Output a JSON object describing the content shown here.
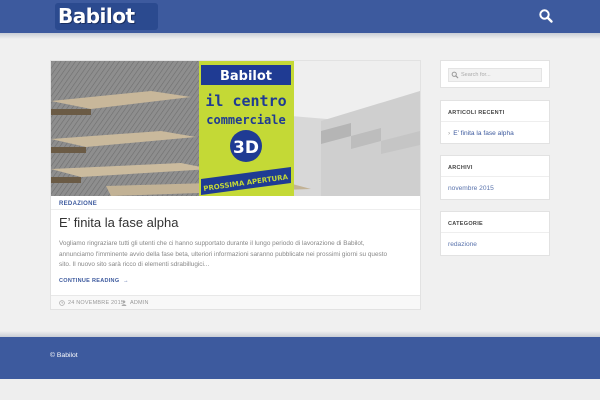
{
  "header": {
    "logo_text": "Babilot",
    "search_icon": "search-icon",
    "color": "#3d5a9e"
  },
  "post": {
    "hero_sign": {
      "brand": "Babilot",
      "line1": "il centro",
      "line2": "commerciale",
      "line3": "3D",
      "banner": "PROSSIMA APERTURA"
    },
    "category": "REDAZIONE",
    "title": "E’ finita la fase alpha",
    "excerpt": "Vogliamo ringraziare tutti gli utenti che ci hanno supportato durante il lungo periodo di lavorazione di Babilot, annunciamo l'imminente avvio della fase beta, ulteriori informazioni saranno pubblicate nei prossimi giorni su questo sito. Il nuovo sito sarà ricco di elementi sdrabillugici...",
    "read_more": "CONTINUE READING",
    "date": "24 NOVEMBRE 2015",
    "author": "ADMIN"
  },
  "sidebar": {
    "search_placeholder": "Search for...",
    "recent_title": "ARTICOLI RECENTI",
    "recent_items": [
      "E’ finita la fase alpha"
    ],
    "archive_title": "ARCHIVI",
    "archive_items": [
      "novembre 2015"
    ],
    "categories_title": "CATEGORIE",
    "category_items": [
      "redazione"
    ]
  },
  "footer": {
    "copyright": "© Babilot"
  }
}
